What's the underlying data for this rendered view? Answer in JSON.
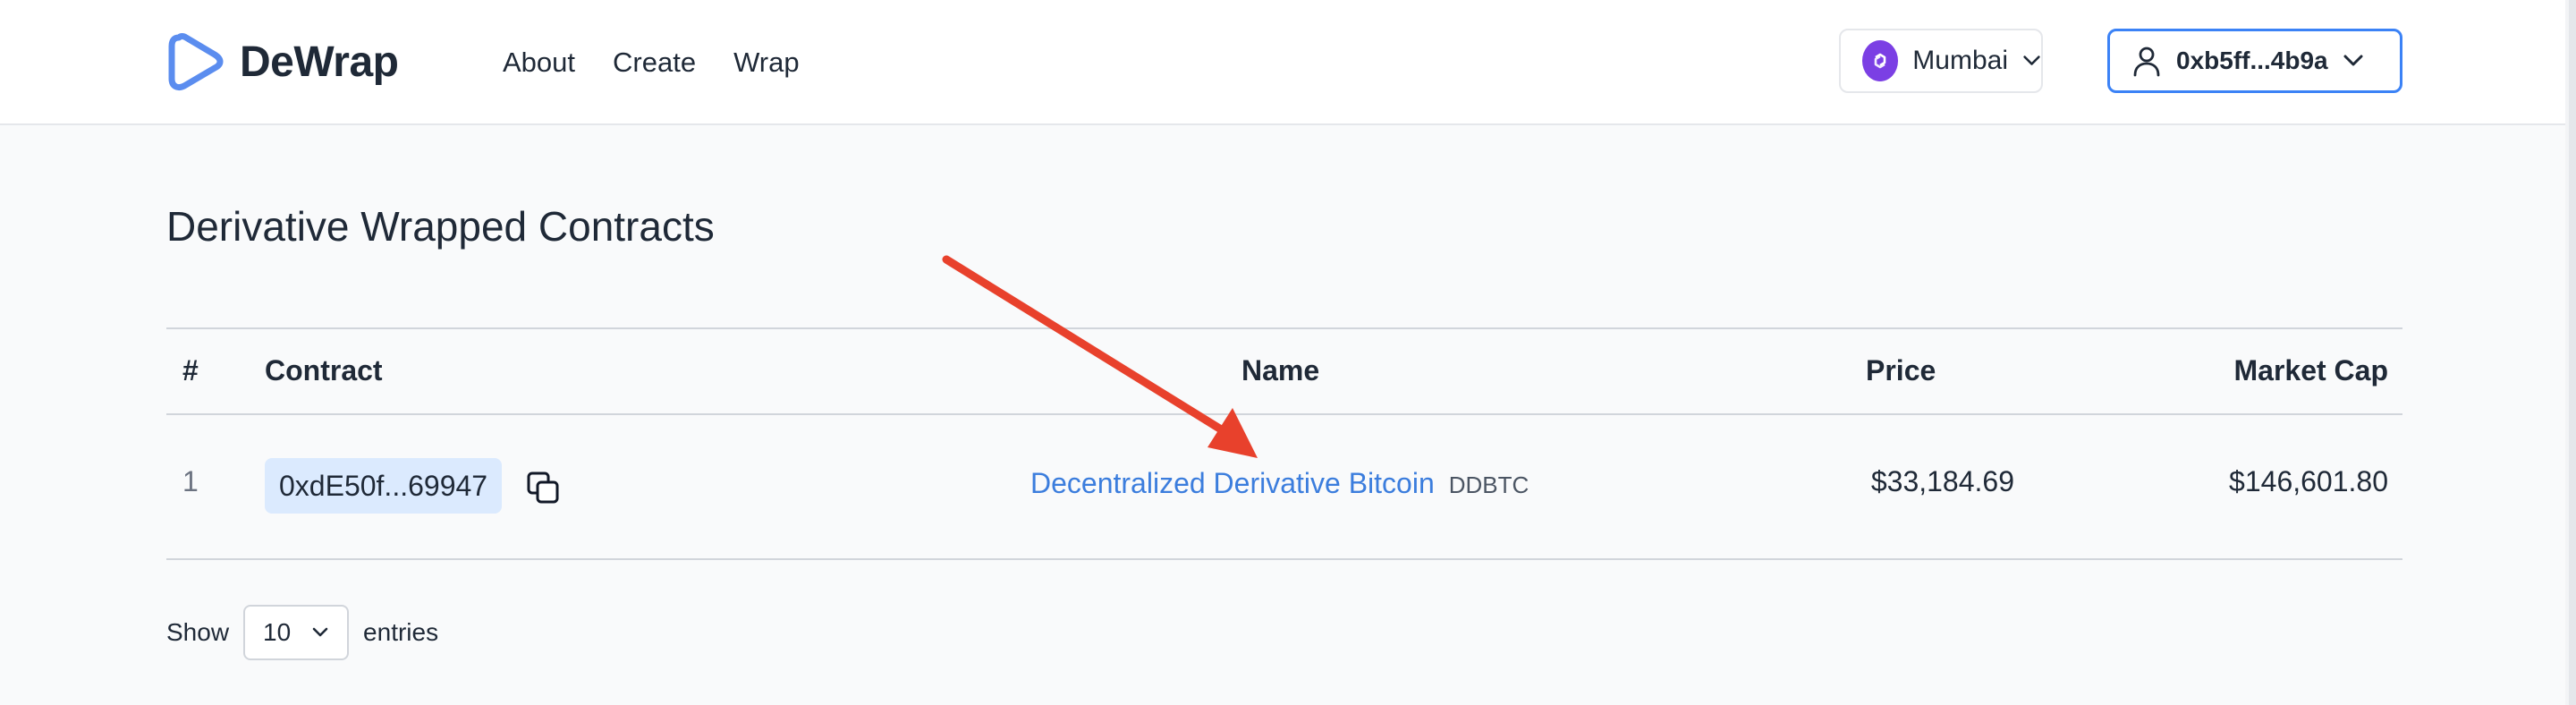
{
  "app": {
    "brand_name": "DeWrap"
  },
  "nav": {
    "items": [
      {
        "label": "About"
      },
      {
        "label": "Create"
      },
      {
        "label": "Wrap"
      }
    ]
  },
  "network": {
    "label": "Mumbai",
    "icon": "polygon-icon",
    "icon_color": "#7b3fe4"
  },
  "wallet": {
    "address": "0xb5ff...4b9a",
    "icon": "user-icon",
    "border_color": "#3b82f6"
  },
  "page": {
    "title": "Derivative Wrapped Contracts"
  },
  "table": {
    "columns": [
      "#",
      "Contract",
      "Name",
      "Price",
      "Market Cap"
    ],
    "rows": [
      {
        "index": "1",
        "contract": "0xdE50f...69947",
        "name": "Decentralized Derivative Bitcoin",
        "symbol": "DDBTC",
        "price": "$33,184.69",
        "market_cap": "$146,601.80"
      }
    ]
  },
  "pagination": {
    "show_label": "Show",
    "entries_value": "10",
    "entries_label": "entries"
  },
  "colors": {
    "link": "#3b7ddd",
    "chip_bg": "#dbeafe",
    "annotation_arrow": "#e8412c"
  }
}
